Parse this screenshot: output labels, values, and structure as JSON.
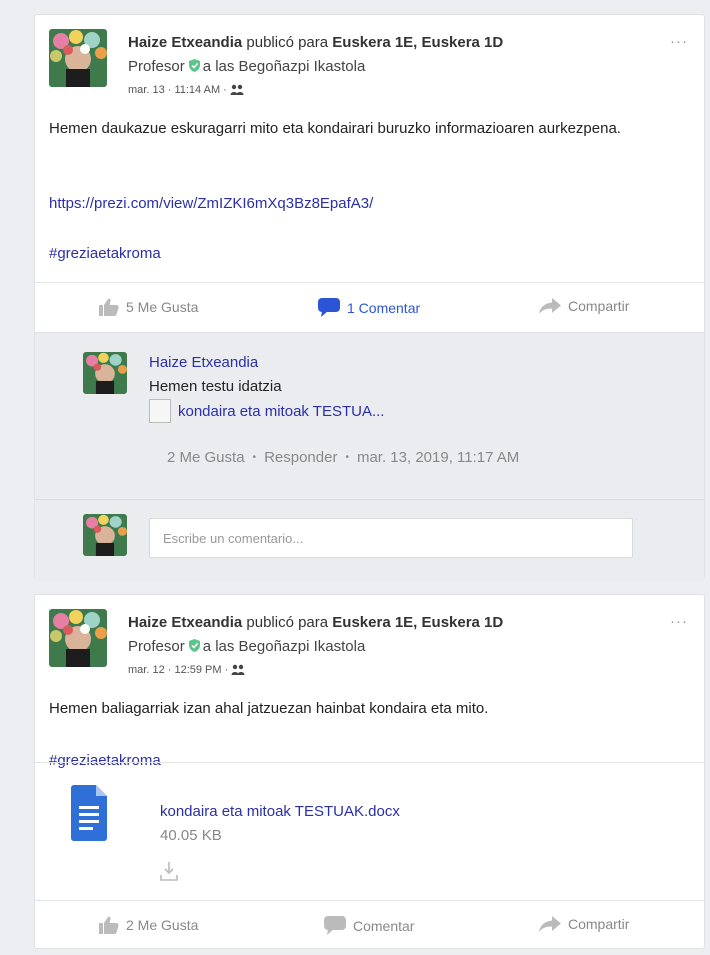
{
  "colors": {
    "link": "#2b2fa8",
    "active_action": "#2c54d6",
    "verified": "#5cc58a",
    "doc": "#2f6fd8"
  },
  "posts": [
    {
      "author": "Haize Etxeandia",
      "published_for": "publicó para",
      "groups": "Euskera 1E,  Euskera 1D",
      "role": "Profesor",
      "school": "a las Begoñazpi Ikastola",
      "date": "mar. 13 · 11:14 AM ·",
      "more_icon": "more-icon",
      "text": "Hemen daukazue eskuragarri mito eta kondairari buruzko informazioaren aurkezpena.",
      "url": "https://prezi.com/view/ZmIZKI6mXq3Bz8EpafA3/",
      "hashtag": "#greziaetakroma",
      "actions": {
        "like": "5 Me Gusta",
        "comment": "1 Comentar",
        "share": "Compartir"
      },
      "comment": {
        "author": "Haize Etxeandia",
        "text": "Hemen testu idatzia",
        "attachment": "kondaira eta mitoak TESTUA...",
        "likes": "2 Me Gusta",
        "reply": "Responder",
        "date": "mar. 13, 2019, 11:17 AM"
      },
      "comment_input_placeholder": "Escribe un comentario..."
    },
    {
      "author": "Haize Etxeandia",
      "published_for": "publicó para",
      "groups": "Euskera 1E,  Euskera 1D",
      "role": "Profesor",
      "school": "a las Begoñazpi Ikastola",
      "date": "mar. 12 · 12:59 PM ·",
      "text": "Hemen baliagarriak izan ahal jatzuezan hainbat kondaira eta mito.",
      "hashtag": "#greziaetakroma",
      "attachment": {
        "name": "kondaira eta mitoak TESTUAK.docx",
        "size": "40.05 KB"
      },
      "actions": {
        "like": "2 Me Gusta",
        "comment": "Comentar",
        "share": "Compartir"
      }
    }
  ]
}
